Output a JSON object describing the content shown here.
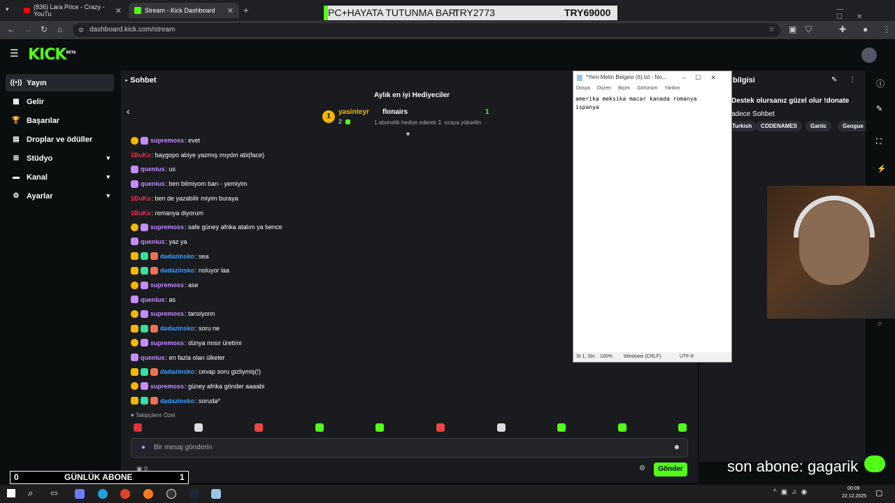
{
  "browser": {
    "tabs": [
      {
        "label": "(836) Lara Price - Crazy - YouTu",
        "close": "✕"
      },
      {
        "label": "Stream - Kick Dashboard",
        "close": "✕"
      }
    ],
    "new_tab": "+",
    "url": "dashboard.kick.com/stream"
  },
  "overlay_banner": {
    "left": "PC+HAYATA TUTUNMA BARI",
    "mid": "TRY2773",
    "right": "TRY69000"
  },
  "kick": {
    "logo": "KICK",
    "logo_sup": "BETA"
  },
  "sidebar": {
    "items": [
      {
        "label": "Yayın",
        "icon": "broadcast-icon"
      },
      {
        "label": "Gelir",
        "icon": "revenue-icon"
      },
      {
        "label": "Başarılar",
        "icon": "trophy-icon"
      },
      {
        "label": "Droplar ve ödüller",
        "icon": "gift-icon"
      },
      {
        "label": "Stüdyo",
        "icon": "studio-icon"
      },
      {
        "label": "Kanal",
        "icon": "channel-icon"
      },
      {
        "label": "Ayarlar",
        "icon": "gear-icon"
      }
    ]
  },
  "chat": {
    "title": "Sohbet",
    "gifters_title": "Aylık en iyi Hediyeciler",
    "gifter1": {
      "name": "yasinteyr",
      "rank": "1",
      "count": "2"
    },
    "gifter2": {
      "name": "flonairs",
      "count": "1",
      "note": "1 abonelik hediye ederek 3. sıraya yükselin"
    },
    "messages": [
      {
        "user": "supremoss",
        "text": ": evet",
        "color": "#c58bff"
      },
      {
        "user": "1BuKs",
        "text": ": baygopo abiye yazmış mıydın abi(face)",
        "color": "#ff2a4f"
      },
      {
        "user": "quenius",
        "text": ": us",
        "color": "#c58bff"
      },
      {
        "user": "quenius",
        "text": ": ben bilmiyom barı - yemiyim",
        "color": "#c58bff"
      },
      {
        "user": "1BuKs",
        "text": ": ben de yazabilir miyim buraya",
        "color": "#ff2a4f"
      },
      {
        "user": "1BuKs",
        "text": ": romanya diyorum",
        "color": "#ff2a4f"
      },
      {
        "user": "supremoss",
        "text": ": safe güney afrika atalım ya bence",
        "color": "#c58bff"
      },
      {
        "user": "quenius",
        "text": ": yaz ya",
        "color": "#c58bff"
      },
      {
        "user": "dadazinsko",
        "text": ": sea",
        "color": "#3fa0ff"
      },
      {
        "user": "dadazinsko",
        "text": ": noluyor laa",
        "color": "#3fa0ff"
      },
      {
        "user": "supremoss",
        "text": ": ase",
        "color": "#c58bff"
      },
      {
        "user": "quenius",
        "text": ": as",
        "color": "#c58bff"
      },
      {
        "user": "supremoss",
        "text": ": tansiyonn",
        "color": "#c58bff"
      },
      {
        "user": "dadazinsko",
        "text": ": soru ne",
        "color": "#3fa0ff"
      },
      {
        "user": "supremoss",
        "text": ": dünya mısır üretimi",
        "color": "#c58bff"
      },
      {
        "user": "quenius",
        "text": ": en fazla olan ülkeler",
        "color": "#c58bff"
      },
      {
        "user": "dadazinsko",
        "text": ": cevap soru gizliymiş(!)",
        "color": "#3fa0ff"
      },
      {
        "user": "supremoss",
        "text": ": güney afrika gönder aaaabi",
        "color": "#c58bff"
      },
      {
        "user": "dadazinsko",
        "text": ": soruda*",
        "color": "#3fa0ff"
      }
    ],
    "followers_only": "Takipçilere Özel",
    "input_placeholder": "Bir mesaj gönderin",
    "points": "0",
    "send_label": "Gönder"
  },
  "right_panel": {
    "title": "bilgisi",
    "line1": "Destek olursanız güzel olur !donate",
    "line2": "adece Sohbet",
    "tags": [
      "Turkish",
      "CODENAMES",
      "Gartic",
      "Geogue"
    ]
  },
  "notepad": {
    "title": "*Yeni Metin Belgesi (6).txt - No...",
    "menu": [
      "Dosya",
      "Düzen",
      "Biçim",
      "Görünüm",
      "Yardım"
    ],
    "line1": "amerika meksika macar kanada romanya",
    "line2": "ispanya",
    "status": {
      "pos": "St 1, Stn",
      "zoom": "100%",
      "eol": "Windows (CRLF)",
      "enc": "UTF-8"
    }
  },
  "counter": {
    "left": "0",
    "label": "GÜNLÜK ABONE",
    "right": "1"
  },
  "last_sub": "son abone: gagarik",
  "taskbar": {
    "time": "00:09",
    "date": "22.12.2025"
  }
}
